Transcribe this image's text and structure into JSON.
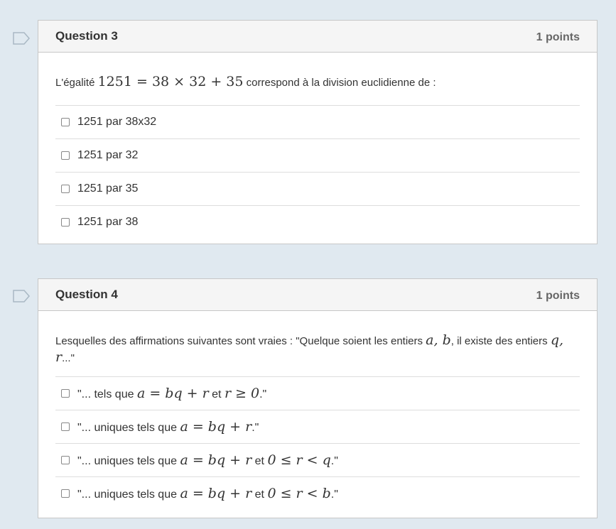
{
  "questions": [
    {
      "title": "Question 3",
      "points": "1 points",
      "prompt_pre": "L'égalité",
      "prompt_math": "1251 = 38 × 32 + 35",
      "prompt_post": "correspond à la division euclidienne de :",
      "options": [
        "1251 par 38x32",
        "1251 par 32",
        "1251 par 35",
        "1251 par 38"
      ]
    },
    {
      "title": "Question 4",
      "points": "1 points",
      "prompt_pre": "Lesquelles des affirmations suivantes sont vraies : \"Quelque soient les entiers",
      "prompt_math1": "a, b",
      "prompt_mid": ", il existe des entiers",
      "prompt_math2": "q, r",
      "prompt_post": "...\"",
      "options": [
        {
          "pre": "\"... tels que",
          "math1": "a = bq + r",
          "mid": "et",
          "math2": "r ≥ 0",
          "post": ".\""
        },
        {
          "pre": "\"... uniques tels que",
          "math1": "a = bq + r",
          "mid": "",
          "math2": "",
          "post": ".\""
        },
        {
          "pre": "\"... uniques tels que",
          "math1": "a = bq + r",
          "mid": "et",
          "math2": "0 ≤ r < q",
          "post": ".\""
        },
        {
          "pre": "\"... uniques tels que",
          "math1": "a = bq + r",
          "mid": "et",
          "math2": "0 ≤ r < b",
          "post": ".\""
        }
      ]
    }
  ]
}
